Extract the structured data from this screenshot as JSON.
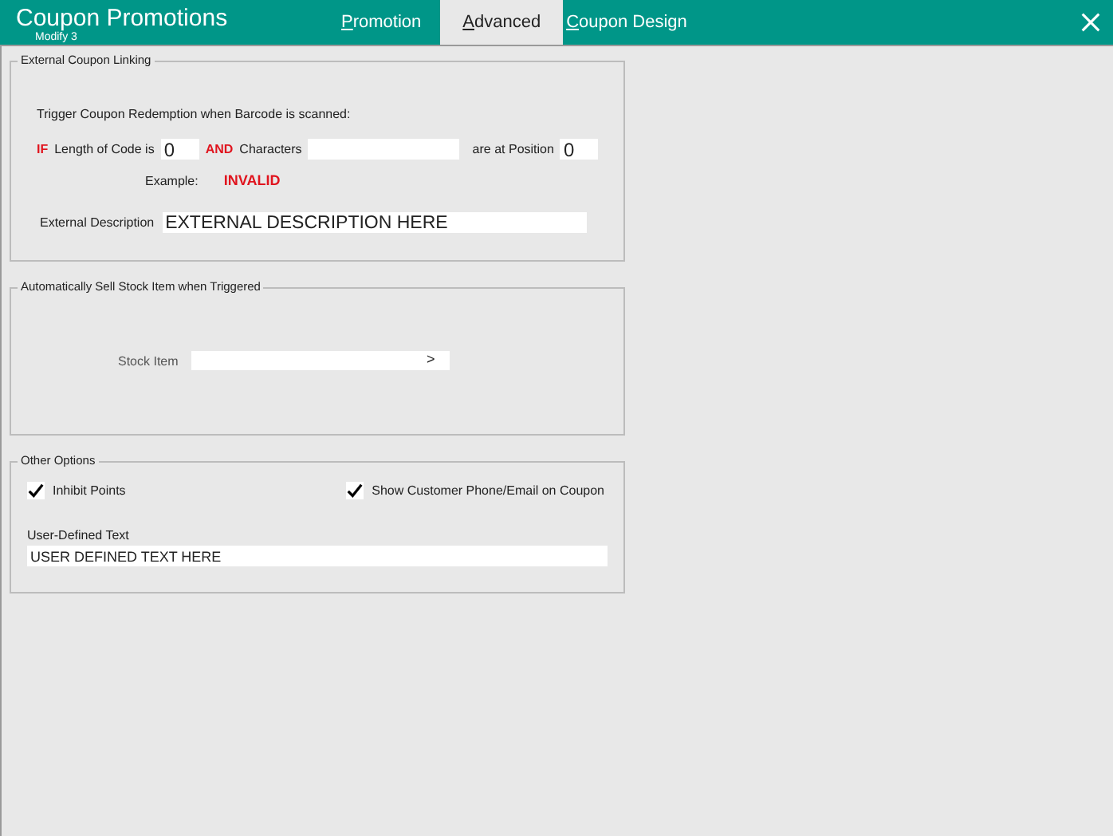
{
  "window": {
    "title": "Coupon Promotions",
    "subtitle": "Modify 3"
  },
  "tabs": [
    {
      "label": "Promotion",
      "selected": false
    },
    {
      "label": "Advanced",
      "selected": true
    },
    {
      "label": "Coupon Design",
      "selected": false
    }
  ],
  "external_linking": {
    "title": "External Coupon Linking",
    "trigger_label": "Trigger Coupon Redemption when Barcode is scanned:",
    "if_label": "IF",
    "length_label": "Length of Code is",
    "length_value": "0",
    "and_label": "AND",
    "characters_label": "Characters",
    "position_label": "are at Position",
    "position_value": "0",
    "example_label": "Example:",
    "example_value": "INVALID",
    "description_label": "External Description",
    "description_value": "EXTERNAL DESCRIPTION HERE"
  },
  "auto_sell": {
    "title": "Automatically Sell Stock Item when Triggered",
    "stock_label": "Stock Item",
    "stock_button": ">"
  },
  "other_options": {
    "title": "Other Options",
    "checkboxes": [
      {
        "label": "Inhibit Points",
        "checked": true
      },
      {
        "label": "Show Customer Phone/Email on Coupon",
        "checked": true
      }
    ],
    "user_text_label": "User-Defined Text",
    "user_text_value": "USER DEFINED TEXT HERE"
  }
}
